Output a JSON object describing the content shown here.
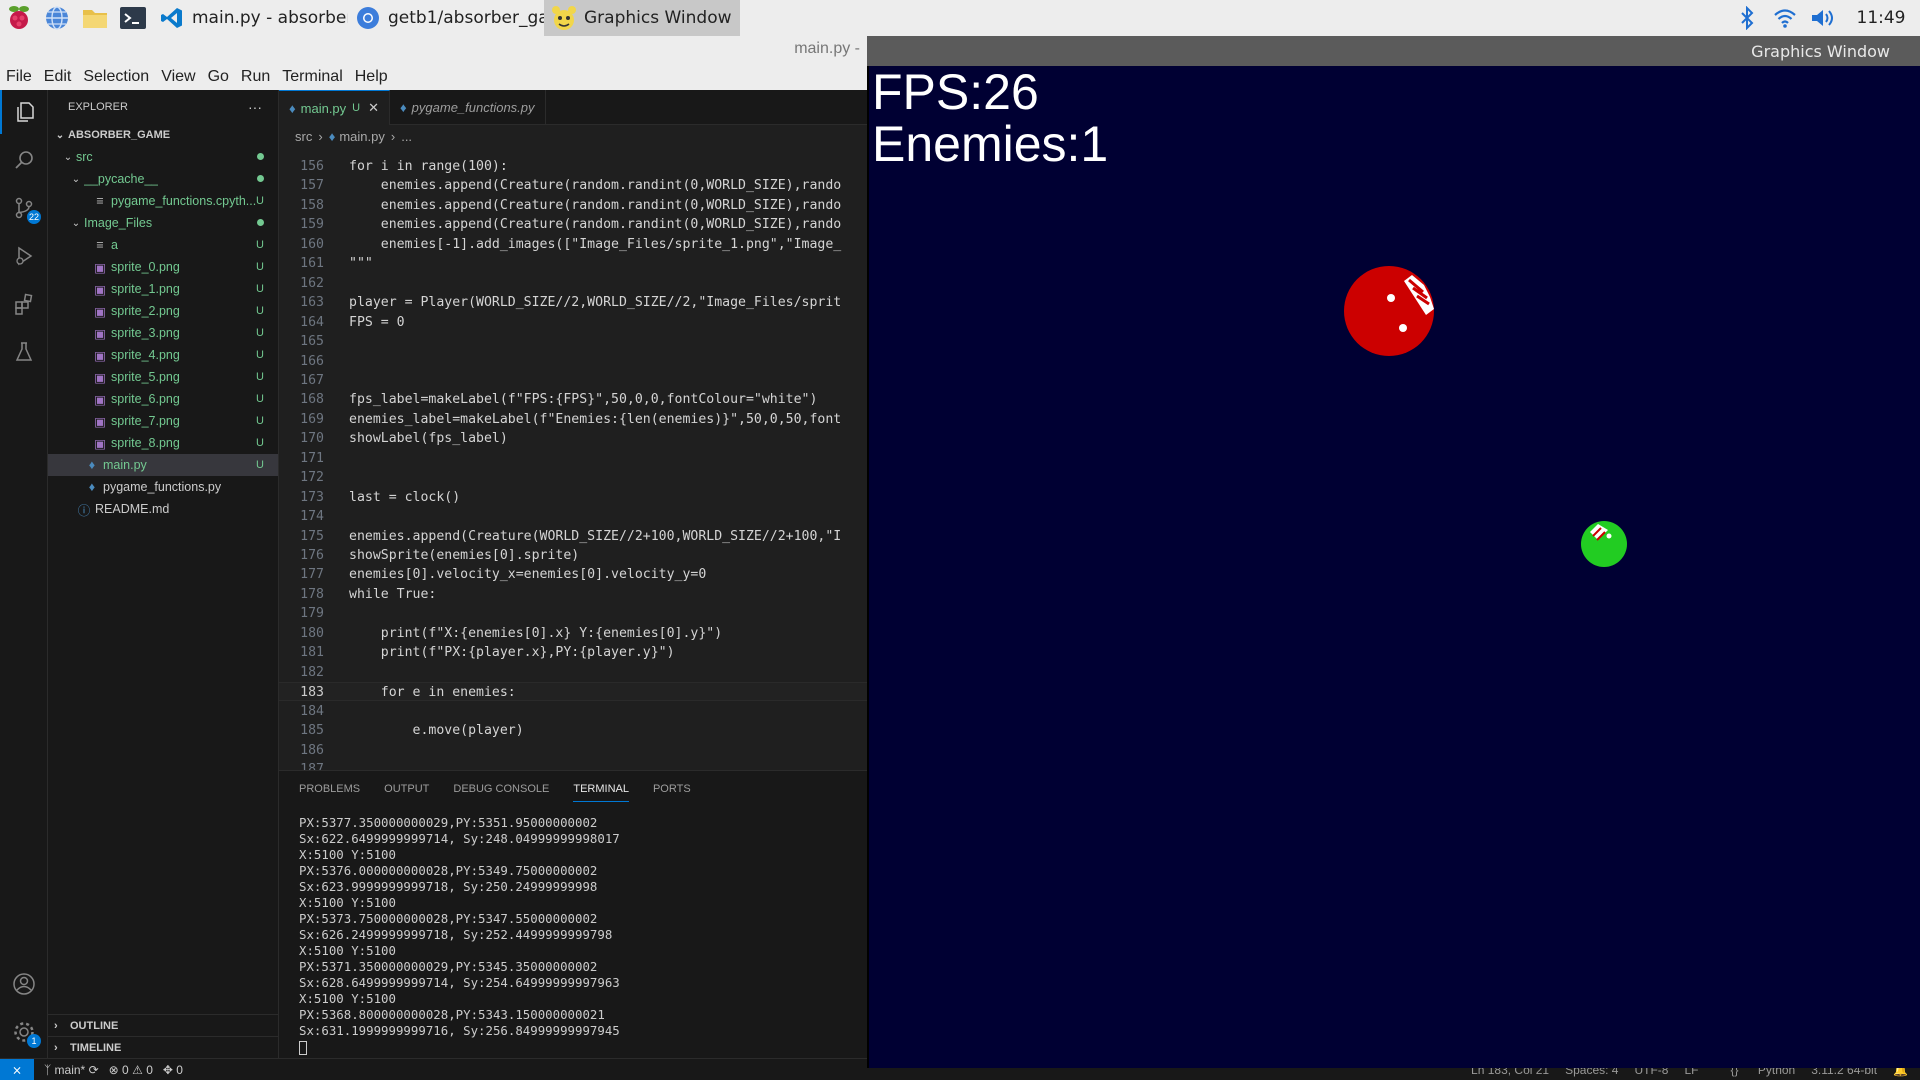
{
  "taskbar": {
    "launchers": [
      {
        "name": "raspberry-menu-icon"
      },
      {
        "name": "web-browser-icon"
      },
      {
        "name": "file-manager-icon"
      },
      {
        "name": "terminal-icon"
      }
    ],
    "tasks": [
      {
        "icon": "vscode-icon",
        "label": "main.py - absorber_g..."
      },
      {
        "icon": "chromium-icon",
        "label": "getb1/absorber_gam..."
      },
      {
        "icon": "pygame-icon",
        "label": "Graphics Window"
      }
    ],
    "clock": "11:49"
  },
  "vscode": {
    "title_fragment": "main.py -",
    "menu": [
      "File",
      "Edit",
      "Selection",
      "View",
      "Go",
      "Run",
      "Terminal",
      "Help"
    ],
    "source_control_badge": "22",
    "settings_badge": "1",
    "explorer": {
      "header": "EXPLORER",
      "more": "···",
      "root": "ABSORBER_GAME",
      "items": [
        {
          "label": "src",
          "depth": 1,
          "type": "folder",
          "status": "dot"
        },
        {
          "label": "__pycache__",
          "depth": 2,
          "type": "folder",
          "status": "dot"
        },
        {
          "label": "pygame_functions.cpyth...",
          "depth": 3,
          "type": "file",
          "status": "U"
        },
        {
          "label": "Image_Files",
          "depth": 2,
          "type": "folder",
          "status": "dot"
        },
        {
          "label": "a",
          "depth": 3,
          "type": "file",
          "status": "U"
        },
        {
          "label": "sprite_0.png",
          "depth": 3,
          "type": "image",
          "status": "U"
        },
        {
          "label": "sprite_1.png",
          "depth": 3,
          "type": "image",
          "status": "U"
        },
        {
          "label": "sprite_2.png",
          "depth": 3,
          "type": "image",
          "status": "U"
        },
        {
          "label": "sprite_3.png",
          "depth": 3,
          "type": "image",
          "status": "U"
        },
        {
          "label": "sprite_4.png",
          "depth": 3,
          "type": "image",
          "status": "U"
        },
        {
          "label": "sprite_5.png",
          "depth": 3,
          "type": "image",
          "status": "U"
        },
        {
          "label": "sprite_6.png",
          "depth": 3,
          "type": "image",
          "status": "U"
        },
        {
          "label": "sprite_7.png",
          "depth": 3,
          "type": "image",
          "status": "U"
        },
        {
          "label": "sprite_8.png",
          "depth": 3,
          "type": "image",
          "status": "U"
        },
        {
          "label": "main.py",
          "depth": 2,
          "type": "python",
          "status": "U",
          "selected": true
        },
        {
          "label": "pygame_functions.py",
          "depth": 2,
          "type": "python",
          "status": ""
        },
        {
          "label": "README.md",
          "depth": 1,
          "type": "info",
          "status": ""
        }
      ],
      "outline": "OUTLINE",
      "timeline": "TIMELINE"
    },
    "tabs": [
      {
        "label": "main.py",
        "status": "U",
        "close": "✕",
        "active": true
      },
      {
        "label": "pygame_functions.py",
        "active": false
      }
    ],
    "breadcrumb": {
      "folder": "src",
      "file": "main.py",
      "tail": "..."
    },
    "code_lines": [
      {
        "n": "156",
        "t": "for i in range(100):"
      },
      {
        "n": "157",
        "t": "    enemies.append(Creature(random.randint(0,WORLD_SIZE),rando"
      },
      {
        "n": "158",
        "t": "    enemies.append(Creature(random.randint(0,WORLD_SIZE),rando"
      },
      {
        "n": "159",
        "t": "    enemies.append(Creature(random.randint(0,WORLD_SIZE),rando"
      },
      {
        "n": "160",
        "t": "    enemies[-1].add_images([\"Image_Files/sprite_1.png\",\"Image_"
      },
      {
        "n": "161",
        "t": "\"\"\""
      },
      {
        "n": "162",
        "t": ""
      },
      {
        "n": "163",
        "t": "player = Player(WORLD_SIZE//2,WORLD_SIZE//2,\"Image_Files/sprit"
      },
      {
        "n": "164",
        "t": "FPS = 0"
      },
      {
        "n": "165",
        "t": ""
      },
      {
        "n": "166",
        "t": ""
      },
      {
        "n": "167",
        "t": ""
      },
      {
        "n": "168",
        "t": "fps_label=makeLabel(f\"FPS:{FPS}\",50,0,0,fontColour=\"white\")"
      },
      {
        "n": "169",
        "t": "enemies_label=makeLabel(f\"Enemies:{len(enemies)}\",50,0,50,font"
      },
      {
        "n": "170",
        "t": "showLabel(fps_label)"
      },
      {
        "n": "171",
        "t": ""
      },
      {
        "n": "172",
        "t": ""
      },
      {
        "n": "173",
        "t": "last = clock()"
      },
      {
        "n": "174",
        "t": ""
      },
      {
        "n": "175",
        "t": "enemies.append(Creature(WORLD_SIZE//2+100,WORLD_SIZE//2+100,\"I"
      },
      {
        "n": "176",
        "t": "showSprite(enemies[0].sprite)"
      },
      {
        "n": "177",
        "t": "enemies[0].velocity_x=enemies[0].velocity_y=0"
      },
      {
        "n": "178",
        "t": "while True:"
      },
      {
        "n": "179",
        "t": ""
      },
      {
        "n": "180",
        "t": "    print(f\"X:{enemies[0].x} Y:{enemies[0].y}\")"
      },
      {
        "n": "181",
        "t": "    print(f\"PX:{player.x},PY:{player.y}\")"
      },
      {
        "n": "182",
        "t": ""
      },
      {
        "n": "183",
        "t": "    for e in enemies:"
      },
      {
        "n": "184",
        "t": ""
      },
      {
        "n": "185",
        "t": "        e.move(player)"
      },
      {
        "n": "186",
        "t": ""
      },
      {
        "n": "187",
        "t": ""
      }
    ],
    "current_line": "183",
    "panel_tabs": [
      "PROBLEMS",
      "OUTPUT",
      "DEBUG CONSOLE",
      "TERMINAL",
      "PORTS"
    ],
    "active_panel_tab": "TERMINAL",
    "terminal_lines": [
      "PX:5377.350000000029,PY:5351.95000000002",
      "Sx:622.6499999999714, Sy:248.04999999998017",
      "X:5100 Y:5100",
      "PX:5376.000000000028,PY:5349.75000000002",
      "Sx:623.9999999999718, Sy:250.24999999998",
      "X:5100 Y:5100",
      "PX:5373.750000000028,PY:5347.55000000002",
      "Sx:626.2499999999718, Sy:252.4499999999798",
      "X:5100 Y:5100",
      "PX:5371.350000000029,PY:5345.35000000002",
      "Sx:628.6499999999714, Sy:254.64999999997963",
      "X:5100 Y:5100",
      "PX:5368.800000000028,PY:5343.150000000021",
      "Sx:631.1999999999716, Sy:256.84999999997945"
    ],
    "status": {
      "branch": "main*",
      "errors": "0",
      "warnings": "0",
      "ports": "0",
      "right": [
        "Ln 183, Col 21",
        "Spaces: 4",
        "UTF-8",
        "LF",
        "Python",
        "3.11.2 64-bit"
      ]
    }
  },
  "graphics_window": {
    "title": "Graphics Window",
    "fps_label": "FPS:26",
    "enemies_label": "Enemies:1",
    "colors": {
      "background": "#000033",
      "enemy": "#cc0000",
      "player": "#22cc22"
    }
  }
}
